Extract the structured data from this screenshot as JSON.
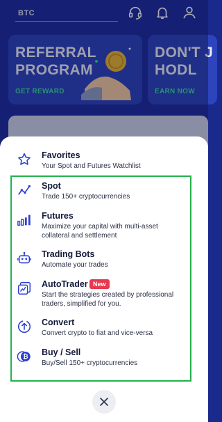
{
  "background": {
    "search": {
      "label": "BTC"
    },
    "banners": [
      {
        "title_line1": "REFERRAL",
        "title_line2": "PROGRAM",
        "link": "GET REWARD"
      },
      {
        "title_line1": "DON'T J",
        "title_line2": "HODL",
        "link": "EARN NOW"
      }
    ]
  },
  "menu": {
    "items": [
      {
        "title": "Favorites",
        "desc": "Your Spot and Futures Watchlist"
      },
      {
        "title": "Spot",
        "desc": "Trade 150+ cryptocurrencies"
      },
      {
        "title": "Futures",
        "desc": "Maximize your capital with multi-asset collateral and settlement"
      },
      {
        "title": "Trading Bots",
        "desc": "Automate your trades"
      },
      {
        "title": "AutoTrader",
        "badge": "New",
        "desc": "Start the strategies created by professional traders, simplified for you."
      },
      {
        "title": "Convert",
        "desc": "Convert crypto to fiat and vice-versa"
      },
      {
        "title": "Buy / Sell",
        "desc": "Buy/Sell 150+ cryptocurrencies"
      }
    ]
  },
  "colors": {
    "accent": "#2b3fd1",
    "highlight": "#22b24c",
    "badge": "#e8384f",
    "reward_link": "#3fd3a7"
  }
}
